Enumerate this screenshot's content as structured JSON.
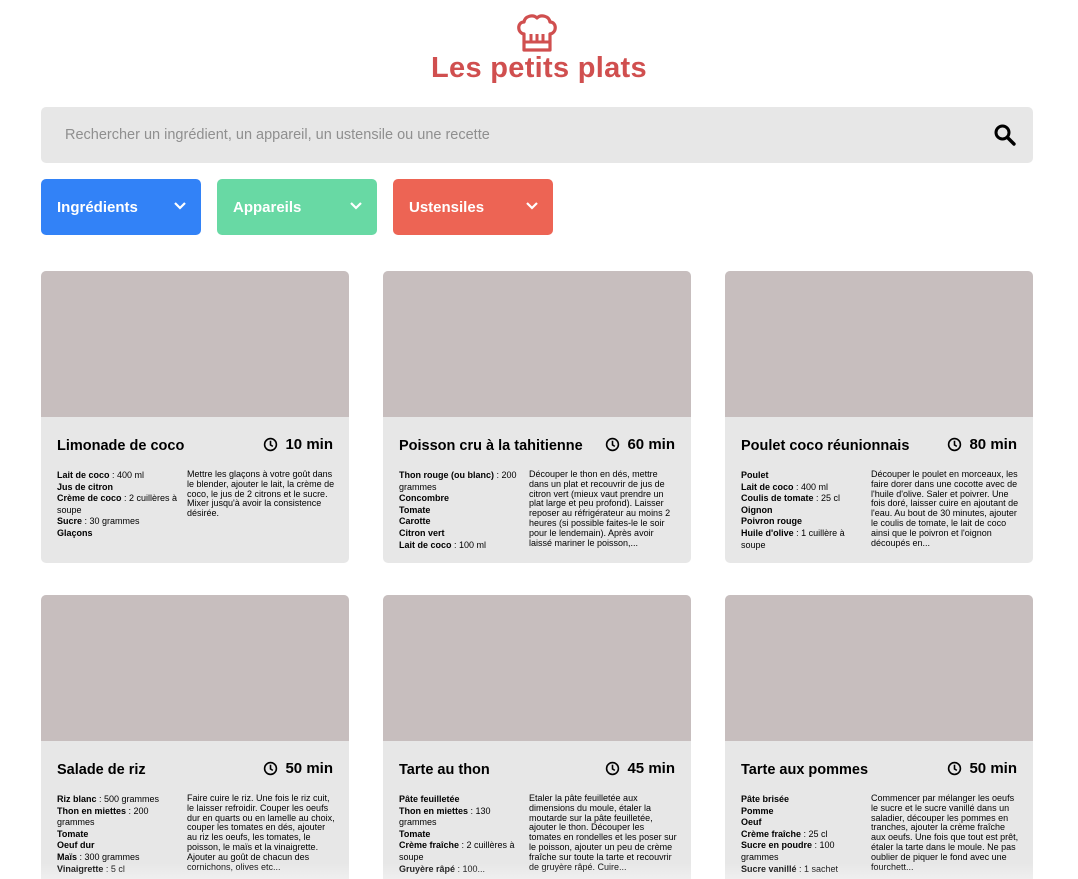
{
  "header": {
    "title": "Les petits plats",
    "logo_icon": "chef-hat-icon",
    "accent": "#D04F4F"
  },
  "search": {
    "placeholder": "Rechercher un ingrédient, un appareil, un ustensile ou une recette",
    "value": "",
    "icon": "search-icon"
  },
  "filters": [
    {
      "label": "Ingrédients",
      "color": "#3282F7",
      "icon": "chevron-down-icon"
    },
    {
      "label": "Appareils",
      "color": "#68D9A4",
      "icon": "chevron-down-icon"
    },
    {
      "label": "Ustensiles",
      "color": "#ED6454",
      "icon": "chevron-down-icon"
    }
  ],
  "recipes": [
    {
      "title": "Limonade de coco",
      "time": "10 min",
      "ingredients": [
        {
          "name": "Lait de coco",
          "qty": " : 400 ml"
        },
        {
          "name": "Jus de citron",
          "qty": ""
        },
        {
          "name": "Crème de coco",
          "qty": " : 2 cuillères à soupe"
        },
        {
          "name": "Sucre",
          "qty": " : 30 grammes"
        },
        {
          "name": "Glaçons",
          "qty": ""
        }
      ],
      "description": "Mettre les glaçons à votre goût dans le blender, ajouter le lait, la crème de coco, le jus de 2 citrons et le sucre. Mixer jusqu'à avoir la consistence désirée."
    },
    {
      "title": "Poisson cru à la tahitienne",
      "time": "60 min",
      "ingredients": [
        {
          "name": "Thon rouge (ou blanc)",
          "qty": " : 200 grammes"
        },
        {
          "name": "Concombre",
          "qty": ""
        },
        {
          "name": "Tomate",
          "qty": ""
        },
        {
          "name": "Carotte",
          "qty": ""
        },
        {
          "name": "Citron vert",
          "qty": ""
        },
        {
          "name": "Lait de coco",
          "qty": " : 100 ml"
        }
      ],
      "description": "Découper le thon en dés, mettre dans un plat et recouvrir de jus de citron vert (mieux vaut prendre un plat large et peu profond). Laisser reposer au réfrigérateur au moins 2 heures (si possible faites-le le soir pour le lendemain). Après avoir laissé mariner le poisson,..."
    },
    {
      "title": "Poulet coco réunionnais",
      "time": "80 min",
      "ingredients": [
        {
          "name": "Poulet",
          "qty": ""
        },
        {
          "name": "Lait de coco",
          "qty": " : 400 ml"
        },
        {
          "name": "Coulis de tomate",
          "qty": " : 25 cl"
        },
        {
          "name": "Oignon",
          "qty": ""
        },
        {
          "name": "Poivron rouge",
          "qty": ""
        },
        {
          "name": "Huile d'olive",
          "qty": " : 1 cuillère à soupe"
        }
      ],
      "description": "Découper le poulet en morceaux, les faire dorer dans une cocotte avec de l'huile d'olive. Saler et poivrer. Une fois doré, laisser cuire en ajoutant de l'eau. Au bout de 30 minutes, ajouter le coulis de tomate, le lait de coco ainsi que le poivron et l'oignon découpés en..."
    },
    {
      "title": "Salade de riz",
      "time": "50 min",
      "ingredients": [
        {
          "name": "Riz blanc",
          "qty": " : 500 grammes"
        },
        {
          "name": "Thon en miettes",
          "qty": " : 200 grammes"
        },
        {
          "name": "Tomate",
          "qty": ""
        },
        {
          "name": "Oeuf dur",
          "qty": ""
        },
        {
          "name": "Maïs",
          "qty": " : 300 grammes"
        },
        {
          "name": "Vinaigrette",
          "qty": " : 5 cl"
        }
      ],
      "description": "Faire cuire le riz. Une fois le riz cuit, le laisser refroidir. Couper les oeufs dur en quarts ou en lamelle au choix, couper les tomates en dés, ajouter au riz les oeufs, les tomates, le poisson, le maïs et la vinaigrette. Ajouter au goût de chacun des cornichons, olives etc..."
    },
    {
      "title": "Tarte au thon",
      "time": "45 min",
      "ingredients": [
        {
          "name": "Pâte feuilletée",
          "qty": ""
        },
        {
          "name": "Thon en miettes",
          "qty": " : 130 grammes"
        },
        {
          "name": "Tomate",
          "qty": ""
        },
        {
          "name": "Crème fraîche",
          "qty": " : 2 cuillères à soupe"
        },
        {
          "name": "Gruyère râpé",
          "qty": " : 100..."
        }
      ],
      "description": "Etaler la pâte feuilletée aux dimensions du moule, étaler la moutarde sur la pâte feuilletée, ajouter le thon. Découper les tomates en rondelles et les poser sur le poisson, ajouter un peu de crème fraîche sur toute la tarte et recouvrir de gruyère râpé. Cuire..."
    },
    {
      "title": "Tarte aux pommes",
      "time": "50 min",
      "ingredients": [
        {
          "name": "Pâte brisée",
          "qty": ""
        },
        {
          "name": "Pomme",
          "qty": ""
        },
        {
          "name": "Oeuf",
          "qty": ""
        },
        {
          "name": "Crème fraîche",
          "qty": " : 25 cl"
        },
        {
          "name": "Sucre en poudre",
          "qty": " : 100 grammes"
        },
        {
          "name": "Sucre vanillé",
          "qty": " : 1 sachet"
        }
      ],
      "description": "Commencer par mélanger les oeufs le sucre et le sucre vanillé dans un saladier, découper les pommes en tranches, ajouter la crème fraîche aux oeufs. Une fois que tout est prêt, étaler la tarte dans le moule. Ne pas oublier de piquer le fond avec une fourchett..."
    }
  ]
}
